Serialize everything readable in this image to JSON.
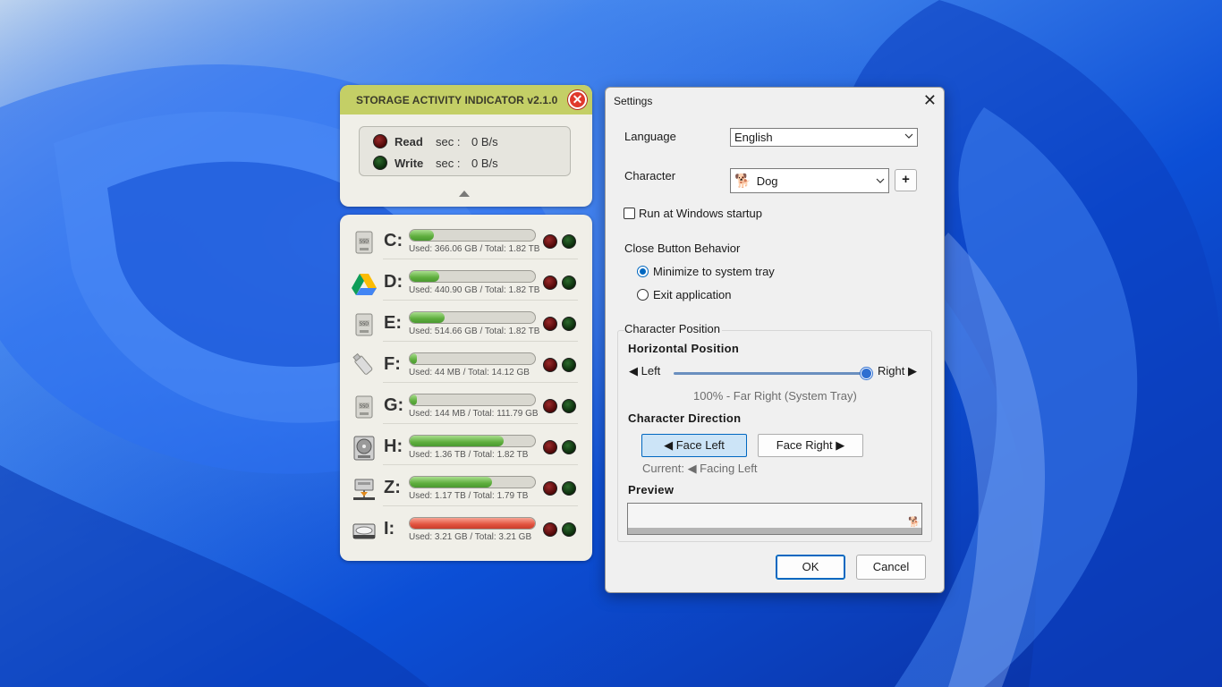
{
  "widget": {
    "title": "STORAGE ACTIVITY INDICATOR  v2.1.0",
    "read_label": "Read",
    "write_label": "Write",
    "sec_label": "sec :",
    "read_rate": "0 B/s",
    "write_rate": "0 B/s",
    "drives": [
      {
        "letter": "C:",
        "info": "Used: 366.06 GB / Total: 1.82 TB",
        "used_fraction": 0.196,
        "icon": "ssd-icon",
        "bar": "green"
      },
      {
        "letter": "D:",
        "info": "Used: 440.90 GB / Total: 1.82 TB",
        "used_fraction": 0.236,
        "icon": "google-drive-icon",
        "bar": "green"
      },
      {
        "letter": "E:",
        "info": "Used: 514.66 GB / Total: 1.82 TB",
        "used_fraction": 0.276,
        "icon": "ssd-icon",
        "bar": "green"
      },
      {
        "letter": "F:",
        "info": "Used: 44 MB / Total: 14.12 GB",
        "used_fraction": 0.003,
        "icon": "usb-drive-icon",
        "bar": "green"
      },
      {
        "letter": "G:",
        "info": "Used: 144 MB / Total: 111.79 GB",
        "used_fraction": 0.001,
        "icon": "ssd-icon",
        "bar": "green"
      },
      {
        "letter": "H:",
        "info": "Used: 1.36 TB / Total: 1.82 TB",
        "used_fraction": 0.747,
        "icon": "hard-disk-icon",
        "bar": "green"
      },
      {
        "letter": "Z:",
        "info": "Used: 1.17 TB / Total: 1.79 TB",
        "used_fraction": 0.654,
        "icon": "network-drive-icon",
        "bar": "green"
      },
      {
        "letter": "I:",
        "info": "Used: 3.21 GB / Total: 3.21 GB",
        "used_fraction": 1.0,
        "icon": "optical-drive-icon",
        "bar": "red"
      }
    ]
  },
  "settings": {
    "title": "Settings",
    "language_label": "Language",
    "language_value": "English",
    "character_label": "Character",
    "character_value": "Dog",
    "character_icon": "dog-icon",
    "add_label": "+",
    "startup_label": "Run at Windows startup",
    "startup_checked": false,
    "close_behavior_label": "Close Button Behavior",
    "close_options": [
      "Minimize to system tray",
      "Exit application"
    ],
    "close_selected": 0,
    "position_group_label": "Character Position",
    "horizontal_label": "Horizontal Position",
    "left_label": "◀ Left",
    "right_label": "Right ▶",
    "horizontal_value": 100,
    "horizontal_status": "100% - Far Right (System Tray)",
    "direction_label": "Character Direction",
    "face_left_label": "◀ Face Left",
    "face_right_label": "Face Right ▶",
    "direction_selected": "left",
    "current_direction": "Current: ◀ Facing Left",
    "preview_label": "Preview",
    "ok_label": "OK",
    "cancel_label": "Cancel"
  },
  "colors": {
    "widget_header": "#c4cf66",
    "accent": "#0067c0",
    "bar_green": "#5fae3e",
    "bar_red": "#e2533f"
  }
}
